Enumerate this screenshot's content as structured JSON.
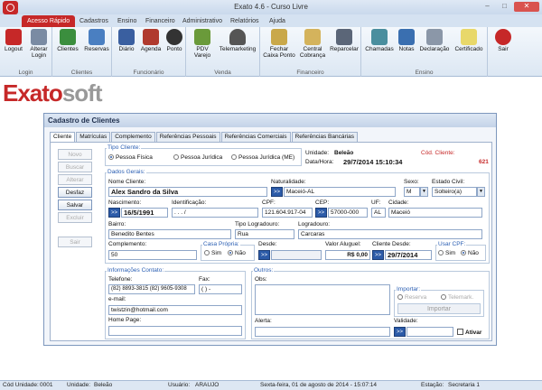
{
  "window": {
    "title": "Exato 4.6 - Curso Livre",
    "minimize": "–",
    "maximize": "□",
    "close": "✕"
  },
  "ribbon_tabs": [
    "Acesso Rápido",
    "Cadastros",
    "Ensino",
    "Financeiro",
    "Administrativo",
    "Relatórios",
    "Ajuda"
  ],
  "ribbon": {
    "groups": {
      "login": "Login",
      "clientes": "Clientes",
      "funcionario": "Funcionário",
      "venda": "Venda",
      "financeiro": "Financeiro",
      "ensino": "Ensino"
    },
    "buttons": {
      "logout": "Logout",
      "alterar_login": "Alterar Login",
      "clientes": "Clientes",
      "reservas": "Reservas",
      "diario": "Diário",
      "agenda": "Agenda",
      "ponto": "Ponto",
      "pdv": "PDV Varejo",
      "telemarketing": "Telemarketing",
      "fechar_caixa": "Fechar Caixa Ponto",
      "central_cobranca": "Central Cobrança",
      "reparcelar": "Reparcelar",
      "chamadas": "Chamadas",
      "notas": "Notas",
      "declaracao": "Declaração",
      "certificado": "Certificado",
      "sair": "Sair"
    }
  },
  "brand": {
    "part1": "Exato",
    "part2": "soft"
  },
  "dialog": {
    "title": "Cadastro de Clientes",
    "tabs": [
      "Cliente",
      "Matrículas",
      "Complemento",
      "Referências Pessoais",
      "Referências Comerciais",
      "Referências Bancárias"
    ],
    "side_buttons": {
      "novo": "Novo",
      "buscar": "Buscar",
      "alterar": "Alterar",
      "desfaz": "Desfaz",
      "salvar": "Salvar",
      "excluir": "Excluir",
      "sair": "Sair"
    },
    "tipo_cliente": {
      "legend": "Tipo Cliente:",
      "fisica": "Pessoa Física",
      "juridica": "Pessoa Jurídica",
      "juridica_me": "Pessoa Jurídica (ME)"
    },
    "unidade_label": "Unidade:",
    "unidade_value": "Beleão",
    "datahora_label": "Data/Hora:",
    "datahora_value": "29/7/2014 15:10:34",
    "cod_cliente_label": "Cód. Cliente:",
    "cod_cliente_value": "621",
    "dados_gerais": "Dados Gerais:",
    "fields": {
      "nome_label": "Nome Cliente:",
      "nome": "Alex Sandro da Silva",
      "naturalidade_label": "Naturalidade:",
      "naturalidade": "Maceió-AL",
      "sexo_label": "Sexo:",
      "sexo": "M",
      "estado_civil_label": "Estado Civil:",
      "estado_civil": "Solteiro(a)",
      "nascimento_label": "Nascimento:",
      "nascimento": "16/5/1991",
      "identificacao_label": "Identificação:",
      "identificacao": ".   .   .     /",
      "cpf_label": "CPF:",
      "cpf": "121.604.917-04",
      "cep_label": "CEP:",
      "cep": "57000-000",
      "uf_label": "UF:",
      "uf": "AL",
      "cidade_label": "Cidade:",
      "cidade": "Maceió",
      "bairro_label": "Bairro:",
      "bairro": "Benedito Bentes",
      "tipo_logradouro_label": "Tipo Logradouro:",
      "tipo_logradouro": "Rua",
      "logradouro_label": "Logradouro:",
      "logradouro": "Carcaras",
      "complemento_label": "Complemento:",
      "complemento": "50",
      "casa_propria_label": "Casa Própria:",
      "sim": "Sim",
      "nao": "Não",
      "desde_label": "Desde:",
      "desde": "",
      "valor_aluguel_label": "Valor Aluguel:",
      "valor_aluguel": "R$ 0,00",
      "cliente_desde_label": "Cliente Desde:",
      "cliente_desde": "29/7/2014",
      "usar_cpf_label": "Usar CPF:"
    },
    "contato": {
      "legend": "Informações Contato:",
      "telefone_label": "Telefone:",
      "telefone": "(82) 8893-3815 (82) 9605-9308",
      "fax_label": "Fax:",
      "fax": "(  )    -",
      "email_label": "e-mail:",
      "email": "twistzin@hotmail.com",
      "homepage_label": "Home Page:",
      "homepage": ""
    },
    "outros": {
      "legend": "Outros:",
      "obs_label": "Obs:",
      "importar_legend": "Importar:",
      "reserva": "Reserva",
      "telemark": "Telemark.",
      "importar_btn": "Importar",
      "alerta_label": "Alerta:",
      "validade_label": "Validade:",
      "ativar": "Ativar"
    },
    "cal": ">>"
  },
  "status": {
    "cod_unidade_label": "Cód Unidade:",
    "cod_unidade": "0001",
    "unidade_label": "Unidade:",
    "unidade": "Beleão",
    "usuario_label": "Usuário:",
    "usuario": "ARAUJO",
    "data": "Sexta-feira, 01 de agosto de 2014 - 15:07:14",
    "estacao_label": "Estação:",
    "estacao": "Secretaria 1"
  },
  "colors": {
    "accent": "#c62828",
    "blue": "#2c5ba8"
  },
  "icons": [
    "logout-icon",
    "key-icon",
    "users-icon",
    "calendar-icon",
    "book-icon",
    "clock-icon",
    "pdv-icon",
    "headset-icon",
    "cashbox-icon",
    "money-icon",
    "calculator-icon",
    "chat-icon",
    "notes-icon",
    "document-icon",
    "certificate-icon",
    "power-icon"
  ]
}
